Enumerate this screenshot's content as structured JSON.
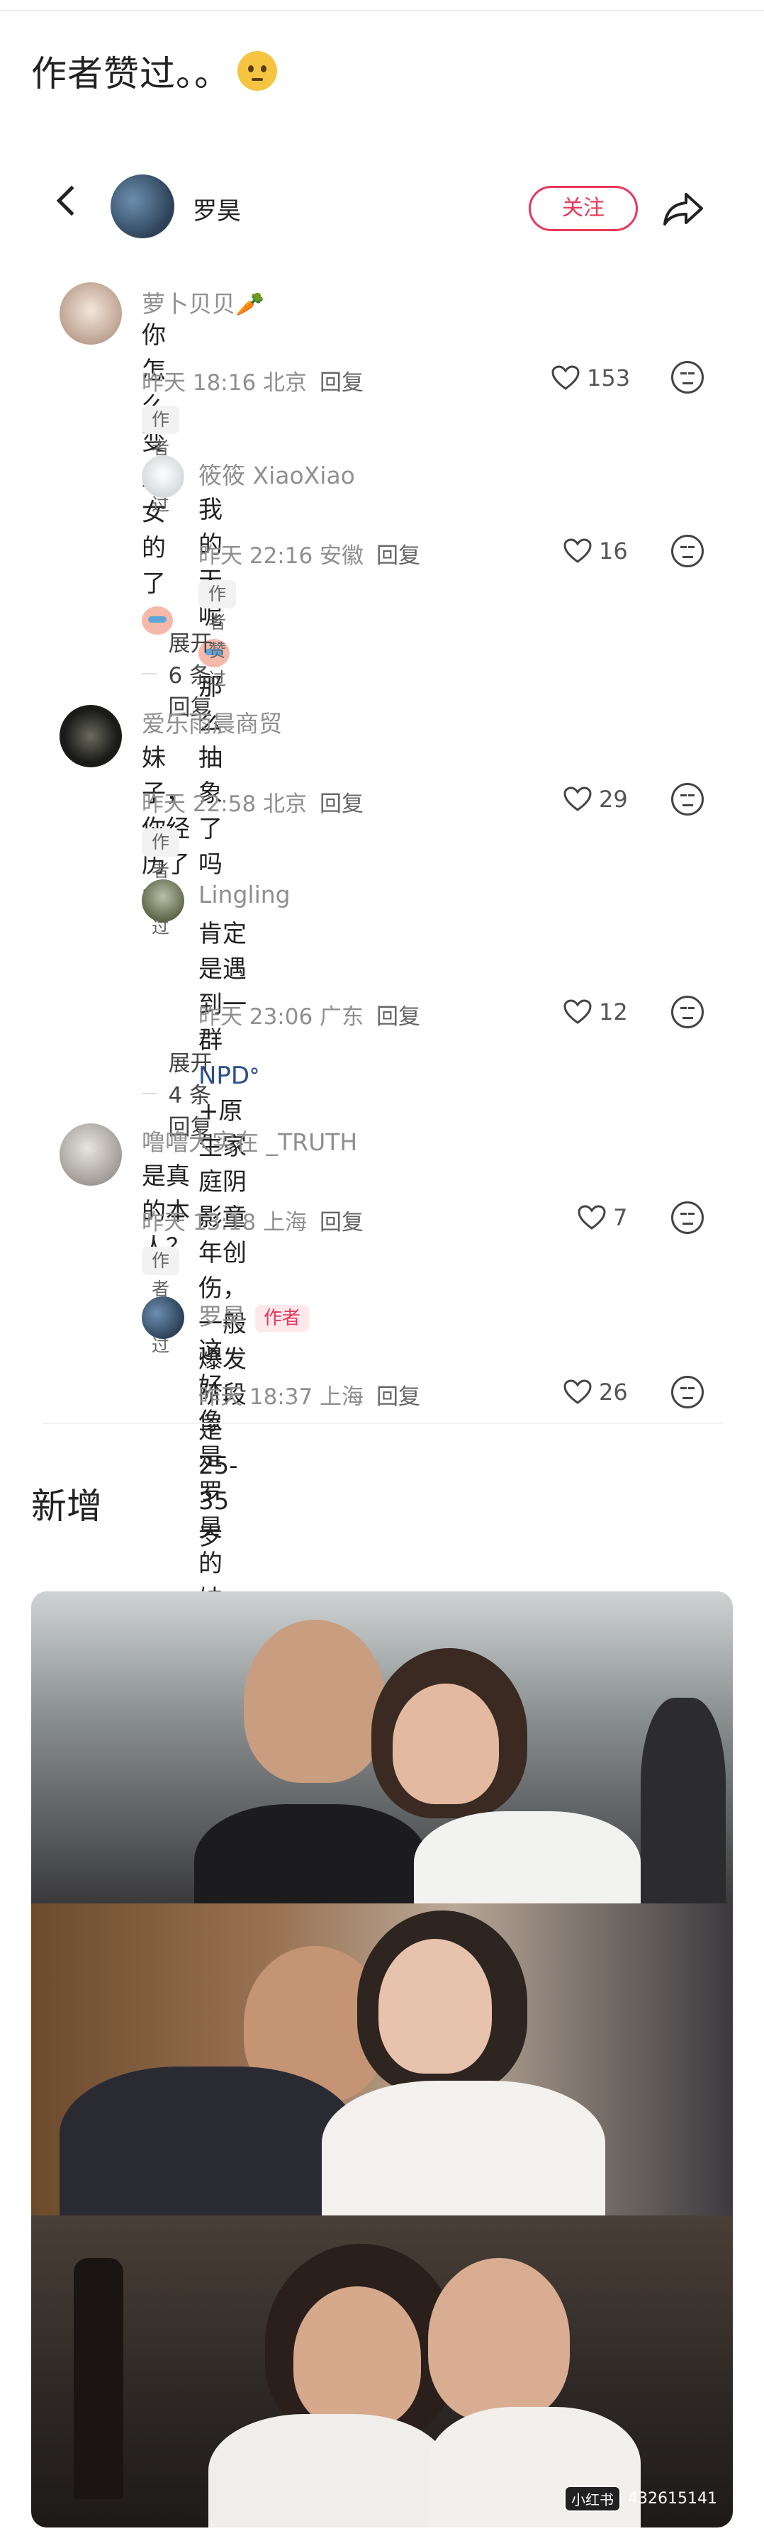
{
  "intro": {
    "text": "作者赞过。。",
    "emoji": "raised-eyebrow-face"
  },
  "header": {
    "name": "罗昊",
    "follow_label": "关注"
  },
  "comments": [
    {
      "user": "萝卜贝贝🥕",
      "text": "你怎么变成女的了",
      "date": "昨天 18:16 北京",
      "reply": "回复",
      "likes": "153",
      "badge": "作者赞过"
    },
    {
      "user": "筱筱 XiaoXiao",
      "text_before": "我的天呢",
      "text_after": "那么抽象了吗",
      "date": "昨天 22:16 安徽",
      "reply": "回复",
      "likes": "16",
      "badge": "作者赞过",
      "expand": "展开 6 条回复"
    },
    {
      "user": "爱乐雨晨商贸",
      "text": "妹子，你经历了啥？",
      "date": "昨天 22:58 北京",
      "reply": "回复",
      "likes": "29",
      "badge": "作者赞过"
    },
    {
      "user": "Lingling",
      "text_line1_before": "肯定是遇到一群 ",
      "npd": "NPDᐤ",
      "text_line1_after": " +原生家庭阴影童年创",
      "text_line2": "伤，一般爆发阶段是 25-35 岁",
      "date": "昨天 23:06 广东",
      "reply": "回复",
      "likes": "12",
      "expand": "展开 4 条回复"
    },
    {
      "user": "噜噜大实在 _TRUTH",
      "text": "是真的本人？",
      "date": "昨天 13:18 上海",
      "reply": "回复",
      "likes": "7",
      "badge": "作者赞过"
    },
    {
      "user": "罗昊",
      "author_tag": "作者",
      "text": "这好像是罗昊的妹妹 罗昊子",
      "date": "昨天 18:37 上海",
      "reply": "回复",
      "likes": "26"
    }
  ],
  "new_section": {
    "title": "新增"
  },
  "photo": {
    "watermark_logo": "小红书",
    "watermark_id": "432615141"
  },
  "colors": {
    "accent": "#e8385a",
    "meta": "#8f8f8f"
  }
}
